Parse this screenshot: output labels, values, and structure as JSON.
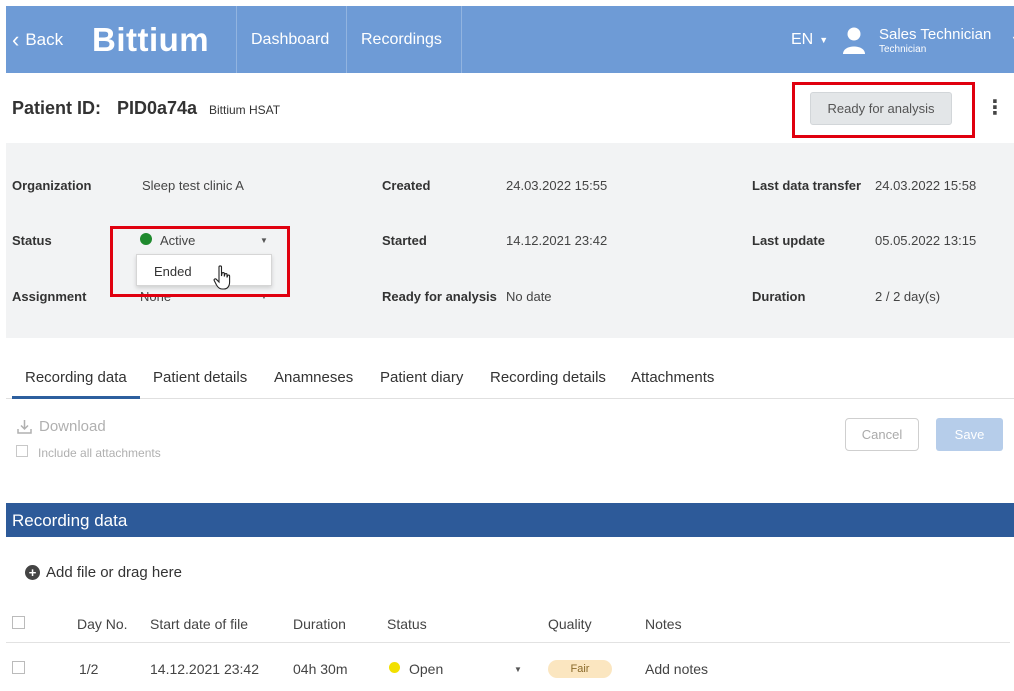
{
  "topbar": {
    "back_label": "Back",
    "logo_text": "Bittium",
    "nav": [
      "Dashboard",
      "Recordings"
    ],
    "language": "EN",
    "user_name": "Sales Technician",
    "user_role": "Technician",
    "bar_color": "#6e9bd6"
  },
  "patient": {
    "id_label": "Patient ID:",
    "id_value": "PID0a74a",
    "device_type": "Bittium HSAT",
    "ready_button": "Ready for analysis"
  },
  "info": {
    "organization_label": "Organization",
    "organization_value": "Sleep test clinic A",
    "status_label": "Status",
    "status_value": "Active",
    "status_color": "#1f8a2e",
    "status_dropdown_option": "Ended",
    "assignment_label": "Assignment",
    "assignment_value": "None",
    "created_label": "Created",
    "created_value": "24.03.2022 15:55",
    "started_label": "Started",
    "started_value": "14.12.2021 23:42",
    "ready_label": "Ready for analysis",
    "ready_value": "No date",
    "last_transfer_label": "Last data transfer",
    "last_transfer_value": "24.03.2022 15:58",
    "last_update_label": "Last update",
    "last_update_value": "05.05.2022 13:15",
    "duration_label": "Duration",
    "duration_value": "2 / 2 day(s)"
  },
  "tabs": [
    {
      "label": "Recording data",
      "active": true
    },
    {
      "label": "Patient details",
      "active": false
    },
    {
      "label": "Anamneses",
      "active": false
    },
    {
      "label": "Patient diary",
      "active": false
    },
    {
      "label": "Recording details",
      "active": false
    },
    {
      "label": "Attachments",
      "active": false
    }
  ],
  "actions": {
    "download_label": "Download",
    "include_attachments_label": "Include all attachments",
    "cancel_label": "Cancel",
    "save_label": "Save"
  },
  "recording": {
    "section_title": "Recording data",
    "section_color": "#2d5a99",
    "add_file_label": "Add file or drag here",
    "columns": [
      "Day No.",
      "Start date of file",
      "Duration",
      "Status",
      "Quality",
      "Notes"
    ],
    "rows": [
      {
        "day": "1/2",
        "start": "14.12.2021 23:42",
        "duration": "04h 30m",
        "status": "Open",
        "status_color": "#f2e000",
        "quality": "Fair",
        "notes": "Add notes"
      }
    ]
  },
  "icons": [
    "chevron-left-icon",
    "user-icon",
    "caret-down-icon",
    "kebab-menu-icon",
    "download-icon",
    "plus-circle-icon",
    "hand-cursor-icon"
  ]
}
